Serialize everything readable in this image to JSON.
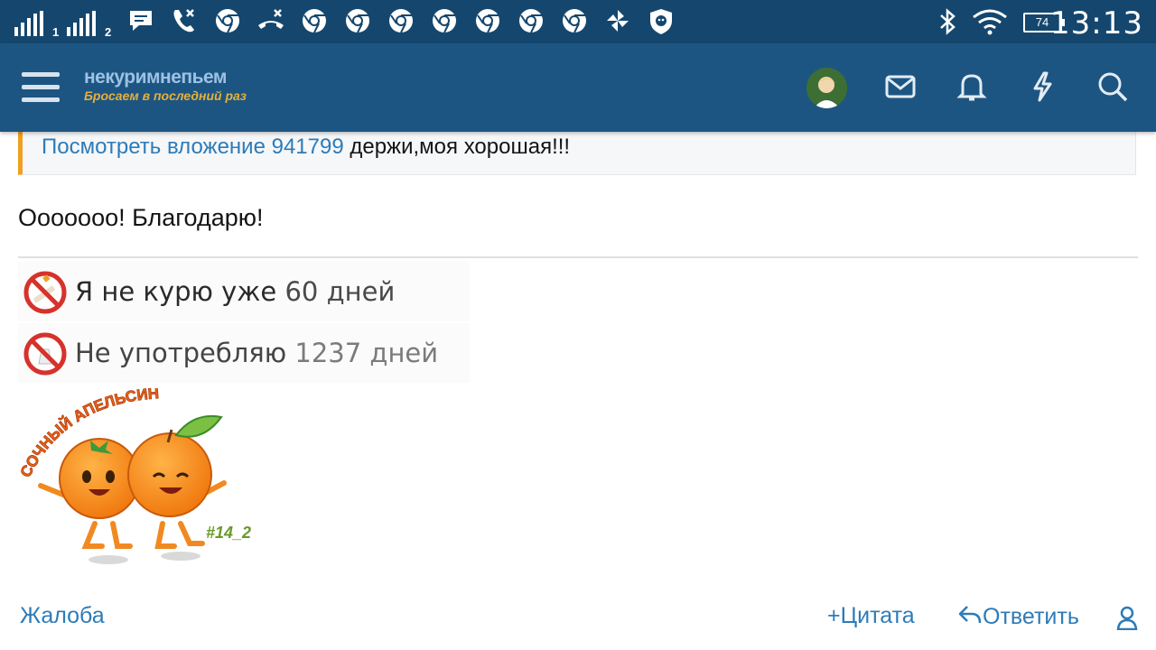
{
  "status_bar": {
    "sim1_label": "1",
    "sim2_label": "2",
    "battery": "74",
    "time": "13:13"
  },
  "header": {
    "logo_title": "некуримнепьем",
    "logo_tagline": "Бросаем в последний раз",
    "icons": [
      "menu-icon",
      "avatar",
      "mail-icon",
      "bell-icon",
      "lightning-icon",
      "search-icon"
    ]
  },
  "post": {
    "quote_link": "Посмотреть вложение 941799",
    "quote_text": " держи,моя хорошая!!!",
    "message": "Ооооооо! Благодарю!",
    "signature": {
      "line1_text": "Я не курю уже",
      "line1_number": "60 дней",
      "line2_text": "Не употребляю",
      "line2_number": "1237 дней",
      "banner_title": "СОЧНЫЙ АПЕЛЬСИН",
      "banner_tag": "#14_2"
    }
  },
  "actions": {
    "report": "Жалоба",
    "quote": "Цитата",
    "reply": "Ответить"
  },
  "colors": {
    "status_bar": "#15476e",
    "nav_bar": "#1d5582",
    "link": "#2d7bb8",
    "quote_accent": "#f0a020"
  }
}
